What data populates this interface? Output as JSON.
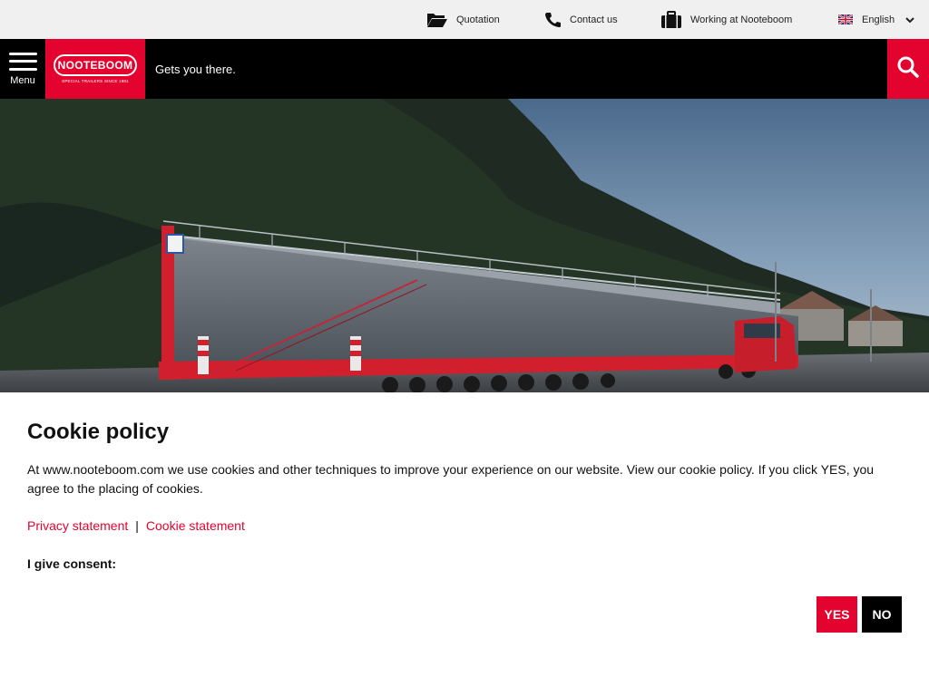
{
  "topbar": {
    "quotation": "Quotation",
    "contact": "Contact us",
    "working": "Working at Nooteboom",
    "language": "English"
  },
  "nav": {
    "menu_label": "Menu",
    "logo_text": "NOOTEBOOM",
    "logo_sub": "SPECIAL TRAILERS SINCE 1881",
    "tagline": "Gets you there."
  },
  "cookie": {
    "title": "Cookie policy",
    "text": "At www.nooteboom.com we use cookies and other techniques to improve your experience on our website. View our cookie policy. If you click YES, you agree to the placing of cookies.",
    "privacy_link": "Privacy statement",
    "separator": "|",
    "cookie_link": "Cookie statement",
    "consent_label": "I give consent:",
    "yes_label": "YES",
    "no_label": "NO"
  },
  "colors": {
    "brand_red": "#e4032e",
    "nav_black": "#000000",
    "topbar_bg": "#f0f0f0"
  },
  "icons": {
    "quotation": "folder-icon",
    "contact": "phone-icon",
    "working": "briefcase-icon",
    "language": "uk-flag-icon",
    "dropdown": "chevron-down-icon",
    "menu": "hamburger-icon",
    "search": "search-icon"
  }
}
